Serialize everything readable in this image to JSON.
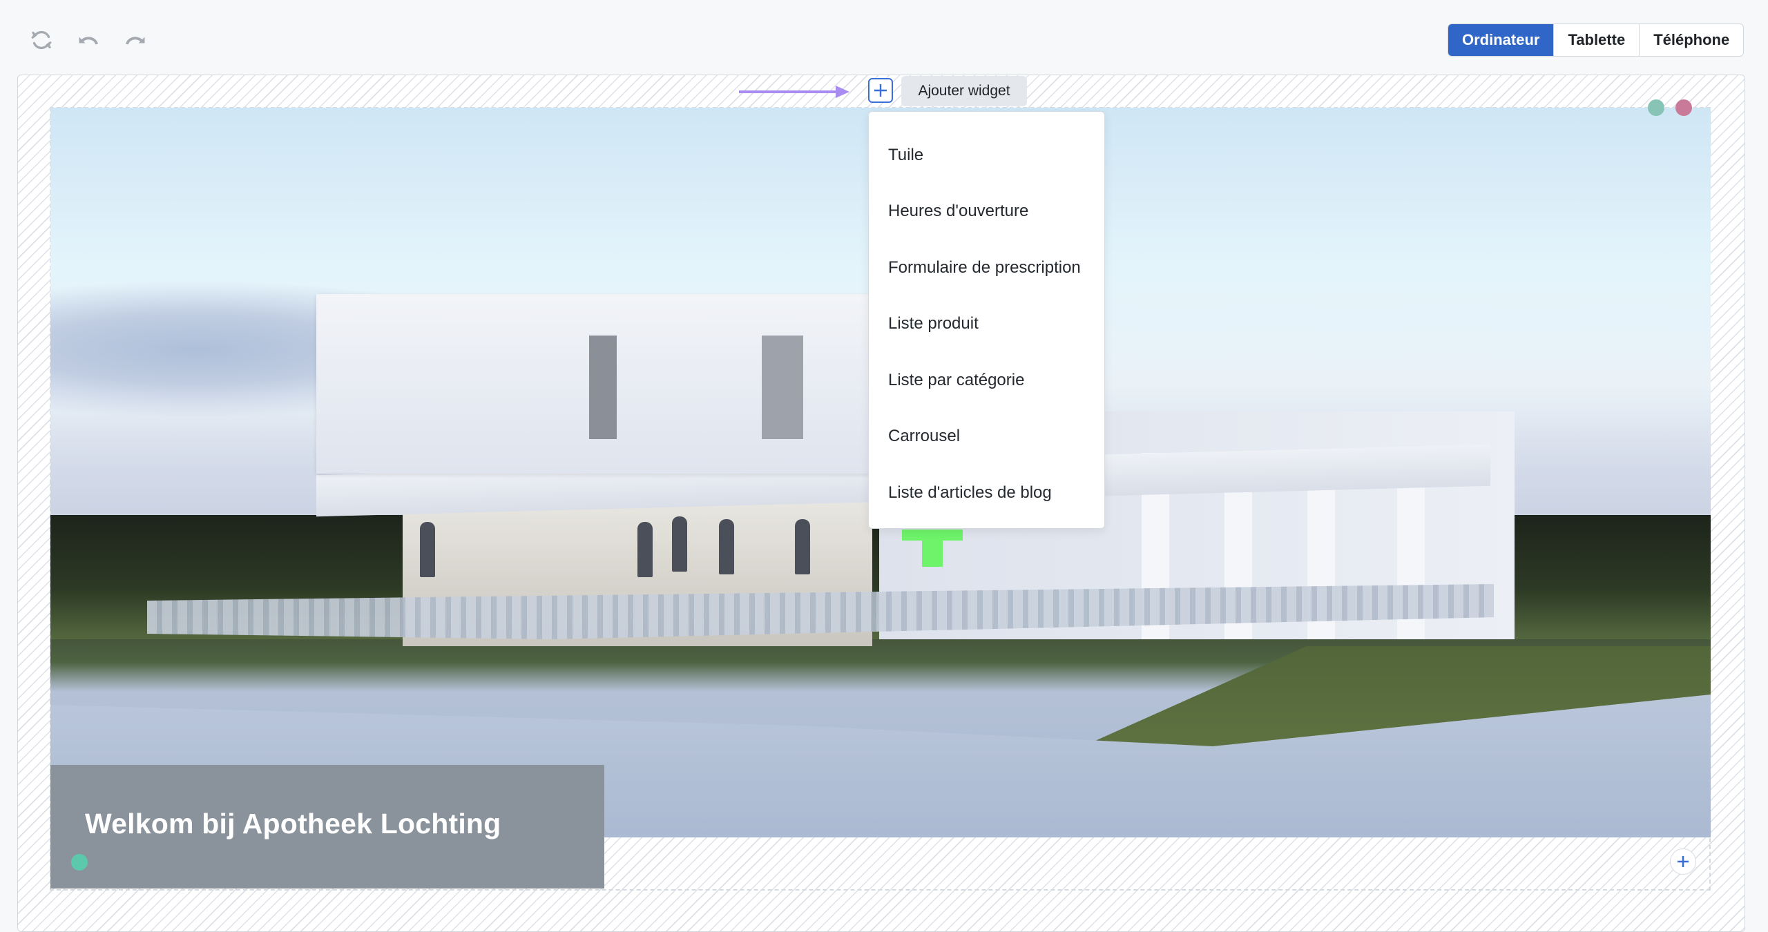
{
  "toolbar": {
    "icons": [
      {
        "name": "refresh-icon",
        "label": "Refresh"
      },
      {
        "name": "undo-icon",
        "label": "Undo"
      },
      {
        "name": "redo-icon",
        "label": "Redo"
      }
    ]
  },
  "device_switch": {
    "options": [
      "Ordinateur",
      "Tablette",
      "Téléphone"
    ],
    "selected": "Ordinateur",
    "active_color": "#2f66c8"
  },
  "add_widget": {
    "tooltip": "Ajouter widget",
    "menu_items": [
      "Tuile",
      "Heures d'ouverture",
      "Formulaire de prescription",
      "Liste produit",
      "Liste par catégorie",
      "Carrousel",
      "Liste d'articles de blog"
    ]
  },
  "hero": {
    "caption_title": "Welkom bij Apotheek Lochting",
    "status_dots": {
      "green": "#87c4b5",
      "pink": "#c87a98",
      "caption_dot": "#5cc9ad"
    }
  },
  "colors": {
    "accent_blue": "#2f66c8",
    "arrow_purple": "#a98cf0",
    "pharmacy_cross": "#6ef36a",
    "caption_bg": "#8a939b"
  }
}
